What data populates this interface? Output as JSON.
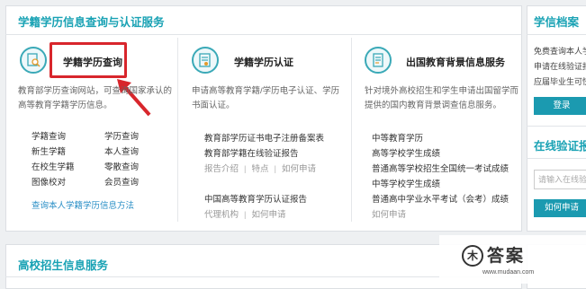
{
  "main": {
    "title": "学籍学历信息查询与认证服务",
    "col1": {
      "title": "学籍学历查询",
      "desc_line1": "教育部学历查询网站，可查询国家承认的",
      "desc_line2": "高等教育学籍学历信息。",
      "links": [
        [
          "学籍查询",
          "学历查询"
        ],
        [
          "新生学籍",
          "本人查询"
        ],
        [
          "在校生学籍",
          "零散查询"
        ],
        [
          "图像校对",
          "会员查询"
        ]
      ],
      "method_link": "查询本人学籍学历信息方法"
    },
    "col2": {
      "title": "学籍学历认证",
      "desc_line1": "申请高等教育学籍/学历电子认证、学历",
      "desc_line2": "书面认证。",
      "item1": "教育部学历证书电子注册备案表",
      "item2": "教育部学籍在线验证报告",
      "sub_links": [
        "报告介绍",
        "特点",
        "如何申请"
      ],
      "item3": "中国高等教育学历认证报告",
      "sub_links2": [
        "代理机构",
        "如何申请"
      ]
    },
    "col3": {
      "title": "出国教育背景信息服务",
      "desc_line1": "针对境外高校招生和学生申请出国留学而",
      "desc_line2": "提供的国内教育背景调查信息服务。",
      "items": [
        "中等教育学历",
        "高等学校学生成绩",
        "普通高等学校招生全国统一考试成绩",
        "中等学校学生成绩",
        "普通高中学业水平考试（会考）成绩"
      ],
      "apply_link": "如何申请"
    }
  },
  "side": {
    "title": "学信档案",
    "text_lines": [
      "免费查询本人学",
      "申请在线验证报",
      "应届毕业生可快"
    ],
    "login_button": "登录",
    "verify_title": "在线验证报",
    "input_placeholder": "请输入在线验",
    "apply_button": "如何申请"
  },
  "bottom": {
    "title": "高校招生信息服务"
  },
  "watermark": {
    "logo": "木",
    "text": "答案",
    "url": "www.mudaan.com"
  },
  "colors": {
    "accent": "#19a2b4",
    "highlight": "#d8262c",
    "link": "#2a8fc6"
  }
}
